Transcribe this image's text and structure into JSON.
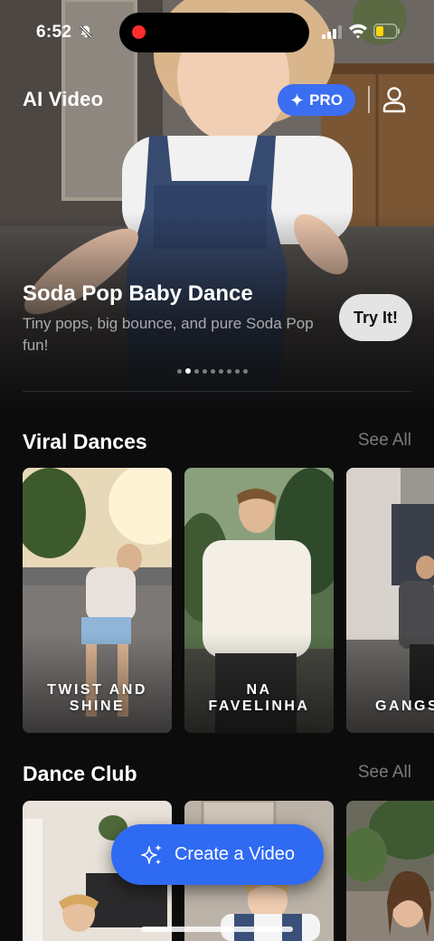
{
  "status_bar": {
    "time": "6:52"
  },
  "header": {
    "title": "AI Video",
    "pro_label": "PRO"
  },
  "hero": {
    "title": "Soda Pop Baby Dance",
    "subtitle": "Tiny pops, big bounce, and pure Soda Pop fun!",
    "cta_label": "Try It!",
    "page_count": 9,
    "active_page": 1
  },
  "sections": {
    "viral": {
      "title": "Viral Dances",
      "see_all": "See All",
      "cards": [
        {
          "label": "TWIST AND\nSHINE"
        },
        {
          "label": "NA\nFAVELINHA"
        },
        {
          "label": "GANGS"
        }
      ]
    },
    "club": {
      "title": "Dance Club",
      "see_all": "See All"
    }
  },
  "create_button": {
    "label": "Create a Video"
  },
  "colors": {
    "accent": "#2f6af2",
    "pro_badge": "#3b6ef0",
    "background": "#0c0c0c"
  }
}
